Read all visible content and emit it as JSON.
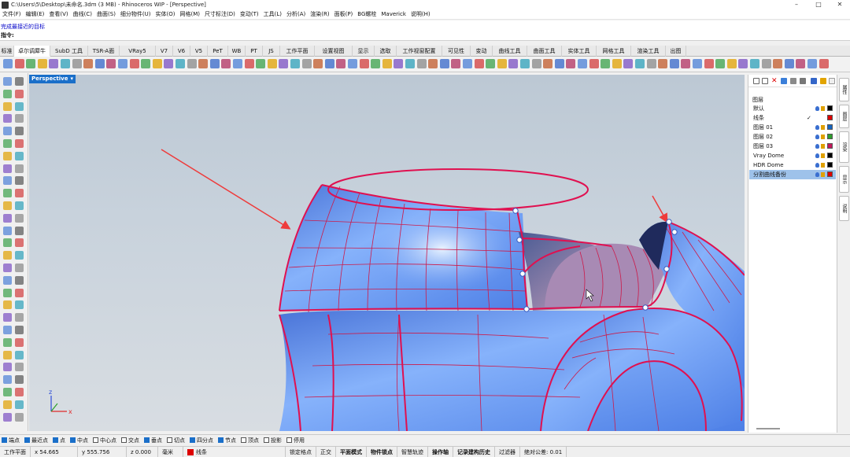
{
  "window": {
    "title": "C:\\Users\\5\\Desktop\\未命名.3dm (3 MB) - Rhinoceros WIP - [Perspective]",
    "minimize": "–",
    "maximize": "□",
    "close": "✕"
  },
  "menu": [
    "文件(F)",
    "编辑(E)",
    "查看(V)",
    "曲线(C)",
    "曲面(S)",
    "细分物件(U)",
    "实体(O)",
    "网格(M)",
    "尺寸标注(D)",
    "变动(T)",
    "工具(L)",
    "分析(A)",
    "渲染(R)",
    "面板(P)",
    "BG螺栓",
    "Maverick",
    "说明(H)"
  ],
  "command": {
    "history": "完成最接近的目标",
    "prompt": "指令:",
    "value": ""
  },
  "tabs": [
    "标准",
    "卓尔调犀牛",
    "SubD 工具",
    "TSR-A面",
    "VRay5",
    "V7",
    "V6",
    "V5",
    "PeT",
    "WB",
    "PT",
    "JS",
    "工作平面",
    "设置视图",
    "显示",
    "选取",
    "工作视窗配置",
    "可见性",
    "变动",
    "曲线工具",
    "曲面工具",
    "实体工具",
    "网格工具",
    "渲染工具",
    "出图"
  ],
  "active_tab_index": 1,
  "viewport": {
    "label": "Perspective",
    "axis_z": "z",
    "axis_x": "x"
  },
  "layers_panel": {
    "title": "图层",
    "check_mark": "✓",
    "layers": [
      {
        "name": "默认",
        "color": "#000000",
        "current": false,
        "selected": false
      },
      {
        "name": "线条",
        "color": "#dd0000",
        "current": true,
        "selected": false
      },
      {
        "name": "图层 01",
        "color": "#1565c0",
        "current": false,
        "selected": false
      },
      {
        "name": "图层 02",
        "color": "#2e9e2e",
        "current": false,
        "selected": false
      },
      {
        "name": "图层 03",
        "color": "#c2185b",
        "current": false,
        "selected": false
      },
      {
        "name": "Vray Dome",
        "color": "#000000",
        "current": false,
        "selected": false
      },
      {
        "name": "HDR Dome",
        "color": "#000000",
        "current": false,
        "selected": false
      },
      {
        "name": "分割曲线备份",
        "color": "#dd0000",
        "current": false,
        "selected": true
      }
    ]
  },
  "side_tabs": [
    "属性",
    "图层",
    "渲染",
    "显示",
    "说明"
  ],
  "osnaps": [
    {
      "label": "端点",
      "on": true
    },
    {
      "label": "最近点",
      "on": true
    },
    {
      "label": "点",
      "on": true
    },
    {
      "label": "中点",
      "on": true
    },
    {
      "label": "中心点",
      "on": false
    },
    {
      "label": "交点",
      "on": false
    },
    {
      "label": "垂点",
      "on": true
    },
    {
      "label": "切点",
      "on": false
    },
    {
      "label": "四分点",
      "on": true
    },
    {
      "label": "节点",
      "on": true
    },
    {
      "label": "顶点",
      "on": false
    },
    {
      "label": "投影",
      "on": false
    },
    {
      "label": "停用",
      "on": false
    }
  ],
  "status": {
    "cplane": "工作平面",
    "x": "x 54.665",
    "y": "y 555.756",
    "z": "z 0.000",
    "units": "毫米",
    "layer": "线条",
    "toggles": [
      "锁定格点",
      "正交",
      "平面模式",
      "物件锁点",
      "智慧轨迹",
      "操作轴",
      "记录建构历史",
      "过滤器"
    ],
    "bold_toggles": [
      "平面模式",
      "物件锁点",
      "操作轴",
      "记录建构历史"
    ],
    "tolerance": "绝对公差: 0.01"
  },
  "colors": {
    "accent": "#1a6fc9",
    "surface": "#5b8ef0",
    "edge": "#e01050",
    "isocurve": "#cc1a4a",
    "arrow": "#ee3b3b"
  }
}
